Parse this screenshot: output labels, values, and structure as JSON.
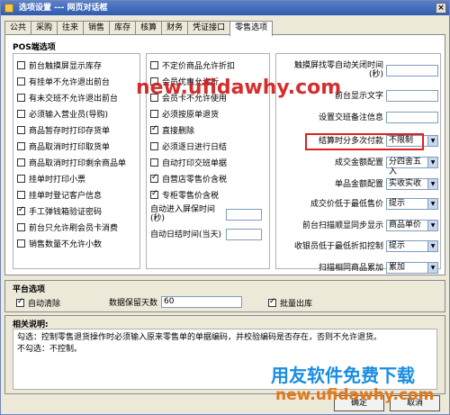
{
  "window": {
    "title": "选项设置 --- 网页对话框",
    "close_label": "×"
  },
  "tabs": [
    "公共",
    "采购",
    "往来",
    "销售",
    "库存",
    "核算",
    "财务",
    "凭证接口",
    "零售选项"
  ],
  "pos": {
    "label": "POS端选项",
    "col1": [
      {
        "label": "前台触摸屏显示库存",
        "checked": false
      },
      {
        "label": "有挂单不允许退出前台",
        "checked": false
      },
      {
        "label": "有未交班不允许退出前台",
        "checked": false
      },
      {
        "label": "必须输入营业员(导购)",
        "checked": false
      },
      {
        "label": "商品暂存时打印存货单",
        "checked": false
      },
      {
        "label": "商品取消时打印取货单",
        "checked": false
      },
      {
        "label": "商品取消时打印剩余商品单",
        "checked": false
      },
      {
        "label": "挂单时打印小票",
        "checked": false
      },
      {
        "label": "挂单时登记客户信息",
        "checked": false
      },
      {
        "label": "手工弹钱箱验证密码",
        "checked": true
      },
      {
        "label": "前台只允许刷会员卡消费",
        "checked": false
      },
      {
        "label": "销售数量不允许小数",
        "checked": false
      }
    ],
    "col2": [
      {
        "label": "不定价商品允许折扣",
        "checked": false
      },
      {
        "label": "会员优惠允许折",
        "checked": false
      },
      {
        "label": "会员卡不允许使用",
        "checked": false
      },
      {
        "label": "必须按原单退货",
        "checked": false
      },
      {
        "label": "直接删除",
        "checked": true
      },
      {
        "label": "必须逐日进行日结",
        "checked": false
      },
      {
        "label": "自动打印交班单据",
        "checked": false
      },
      {
        "label": "自营店零售价含税",
        "checked": true
      },
      {
        "label": "专柜零售价含税",
        "checked": true
      }
    ],
    "col2_fields": [
      {
        "label": "自动进入屏保时间(秒)",
        "value": ""
      },
      {
        "label": "自动日结时间(当天)",
        "value": ""
      }
    ],
    "col3": [
      {
        "label": "触摸屏找零自动关闭时间(秒)",
        "kind": "input",
        "value": ""
      },
      {
        "label": "前台显示文字",
        "kind": "input",
        "value": ""
      },
      {
        "label": "设置交班备注信息",
        "kind": "input",
        "value": ""
      },
      {
        "label": "结算时分多次付款",
        "kind": "select",
        "value": "不限制"
      },
      {
        "label": "成交金额配置",
        "kind": "select",
        "value": "分四舍五入"
      },
      {
        "label": "单品金额配置",
        "kind": "select",
        "value": "实收实收"
      },
      {
        "label": "成交价低于最低售价",
        "kind": "select",
        "value": "提示"
      },
      {
        "label": "前台扫描顺显同步显示",
        "kind": "select",
        "value": "商品单价"
      },
      {
        "label": "收银员低于最低折扣控制",
        "kind": "select",
        "value": "提示"
      },
      {
        "label": "扫描相同商品累加",
        "kind": "select",
        "value": "累加"
      }
    ]
  },
  "platform": {
    "label": "平台选项",
    "auto_clear": "自动清除",
    "keep_days_label": "数据保留天数",
    "keep_days_value": "60",
    "batch_out": "批量出库"
  },
  "description": {
    "label": "相关说明:",
    "line1": "勾选：控制零售退货操作时必须输入原来零售单的单据编码，并校验编码是否存在，否则不允许退货。",
    "line2": "不勾选：不控制。"
  },
  "buttons": {
    "ok": "确定",
    "cancel": "取消"
  },
  "watermarks": {
    "top": "new.ufidawhy.com",
    "brand": "用友软件免费下载",
    "bottom": "new.ufidawhy.com"
  }
}
